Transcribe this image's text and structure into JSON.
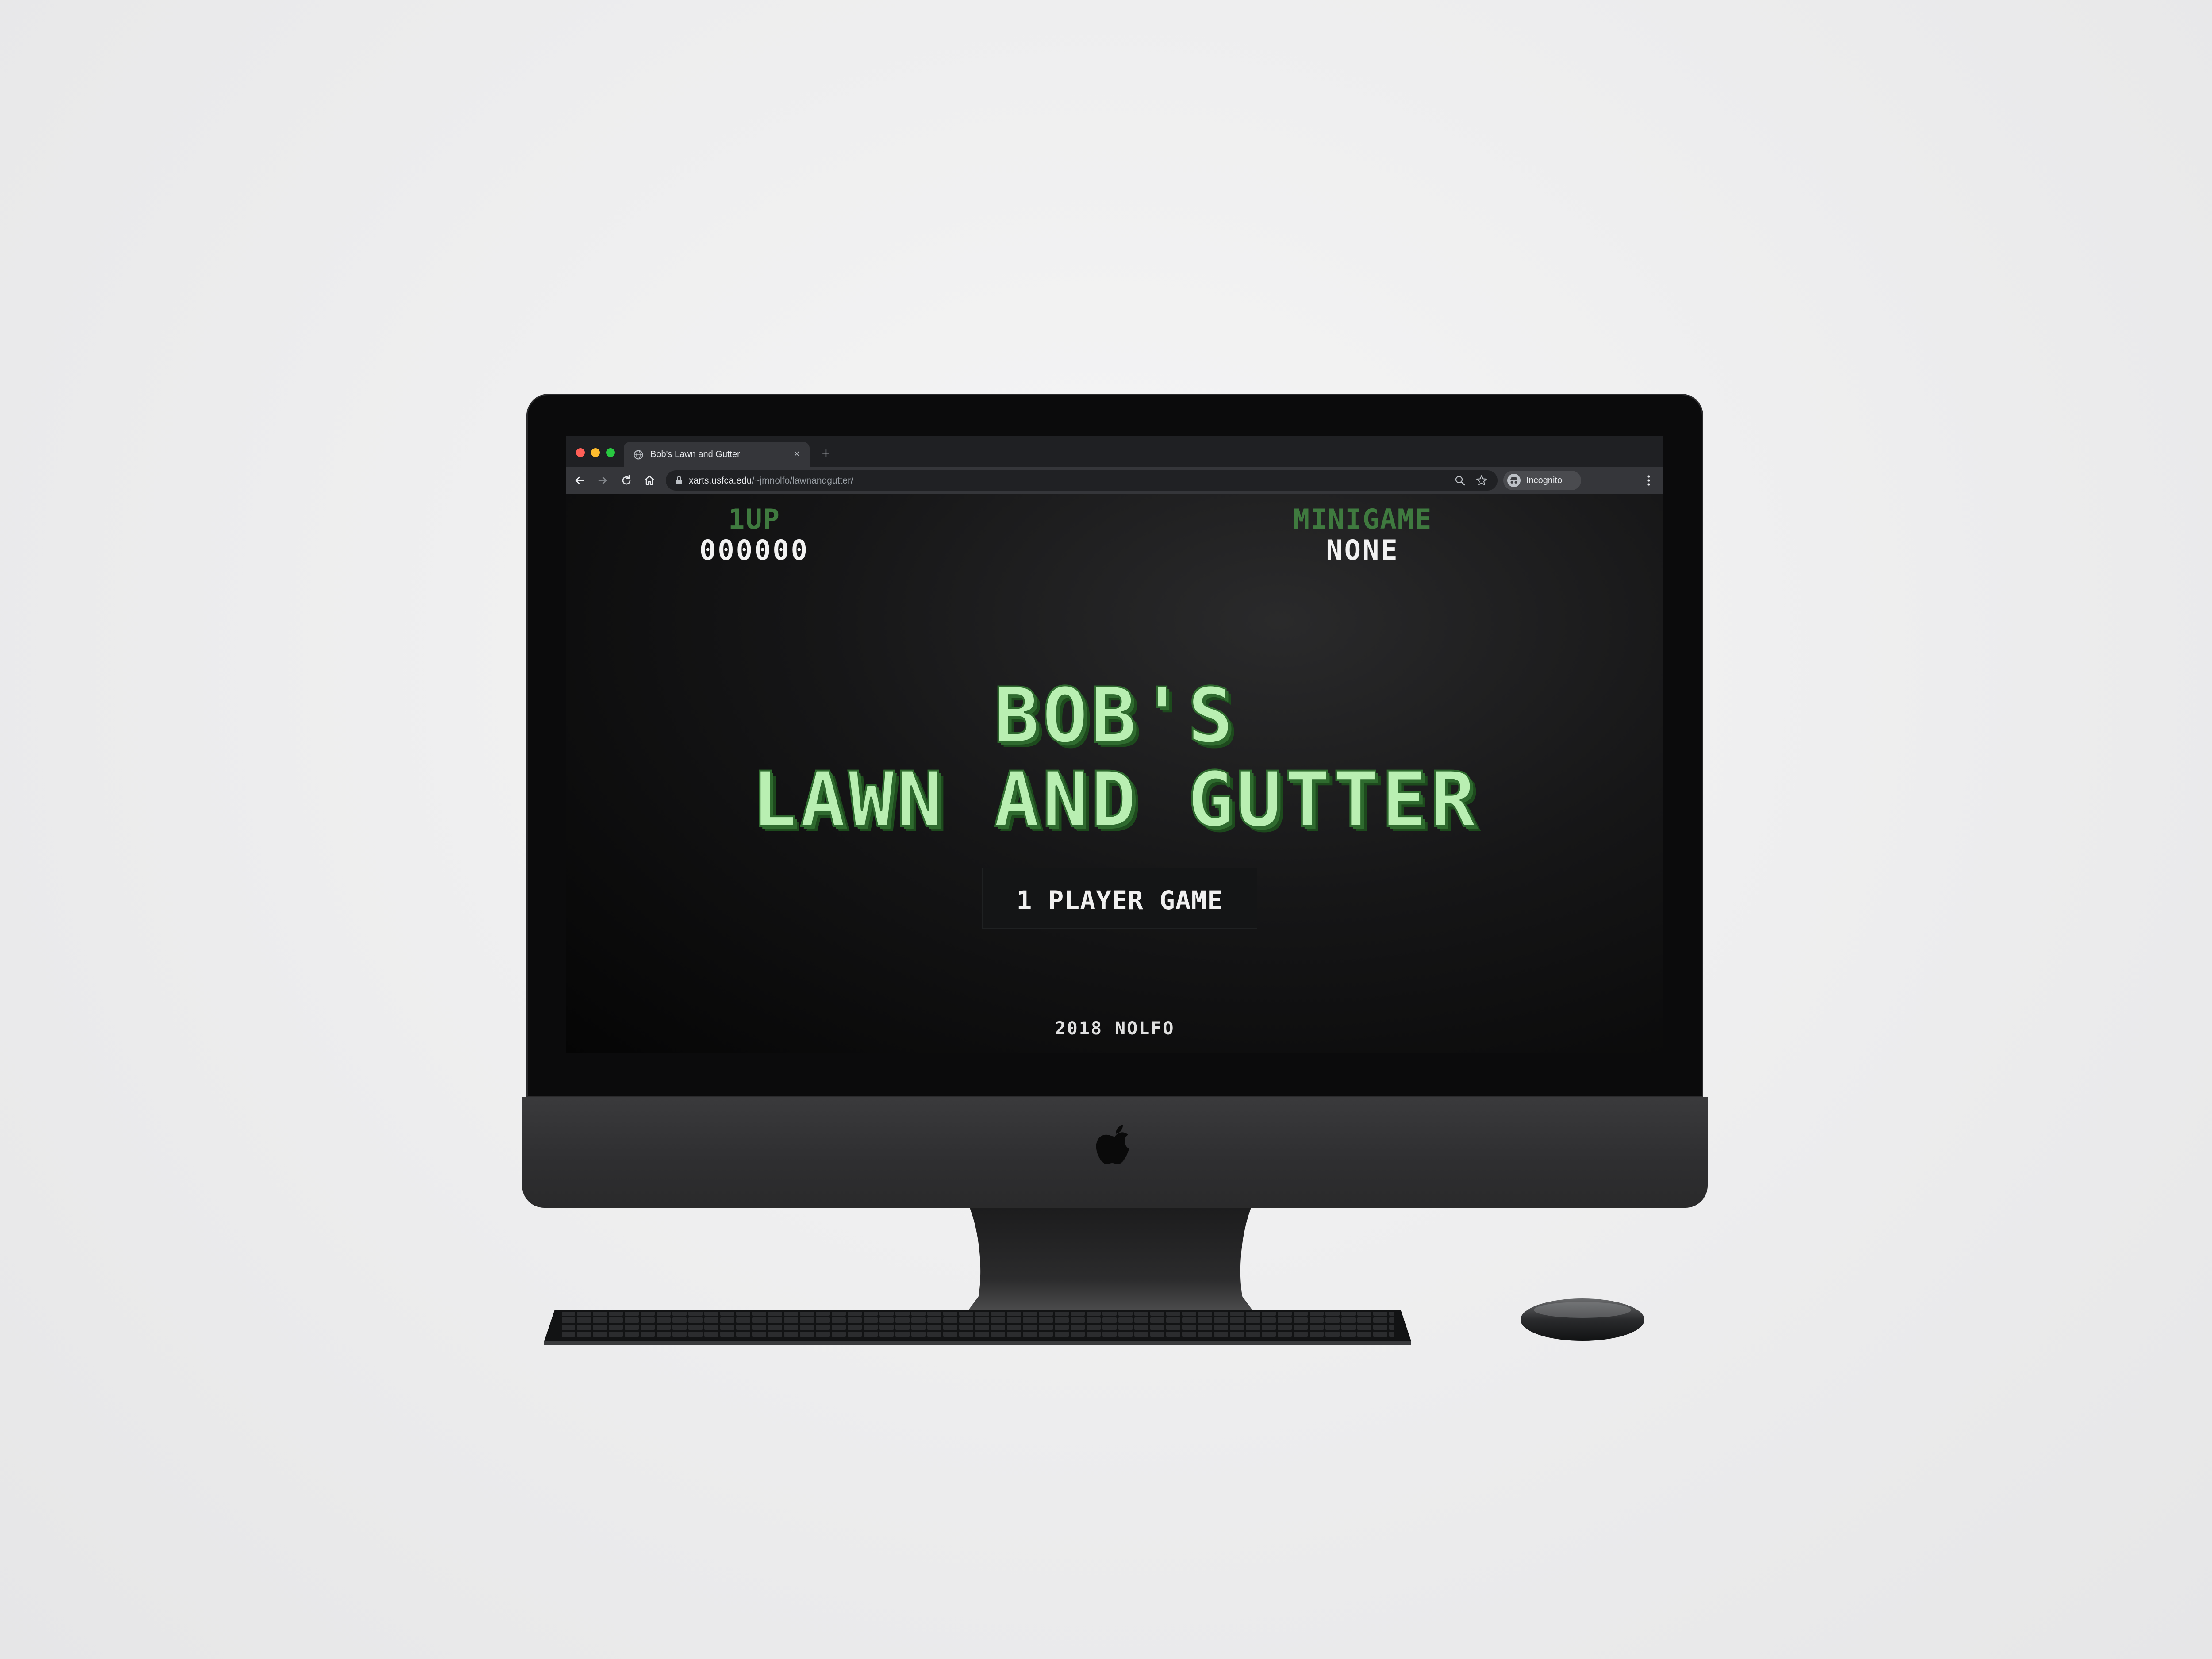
{
  "browser": {
    "tab_title": "Bob's Lawn and Gutter",
    "tab_close": "×",
    "new_tab": "+",
    "url_domain": "xarts.usfca.edu",
    "url_path": "/~jmnolfo/lawnandgutter/",
    "profile_label": "Incognito"
  },
  "hud": {
    "player_label": "1UP",
    "player_score": "000000",
    "minigame_label": "MINIGAME",
    "minigame_value": "NONE"
  },
  "title": {
    "line1": "BOB'S",
    "line2": "LAWN AND GUTTER"
  },
  "menu": {
    "start_label": "1 PLAYER GAME"
  },
  "footer": {
    "credits": "2018 NOLFO"
  },
  "colors": {
    "accent_green": "#3f7a3f",
    "title_fill": "#b9efb2",
    "title_shadow": "#2f6b2f",
    "screen_bg": "#0b0b0c"
  },
  "icons": [
    "back-arrow-icon",
    "forward-arrow-icon",
    "reload-icon",
    "home-icon",
    "lock-icon",
    "zoom-icon",
    "star-icon",
    "incognito-icon",
    "more-menu-icon",
    "globe-icon",
    "apple-logo-icon"
  ]
}
